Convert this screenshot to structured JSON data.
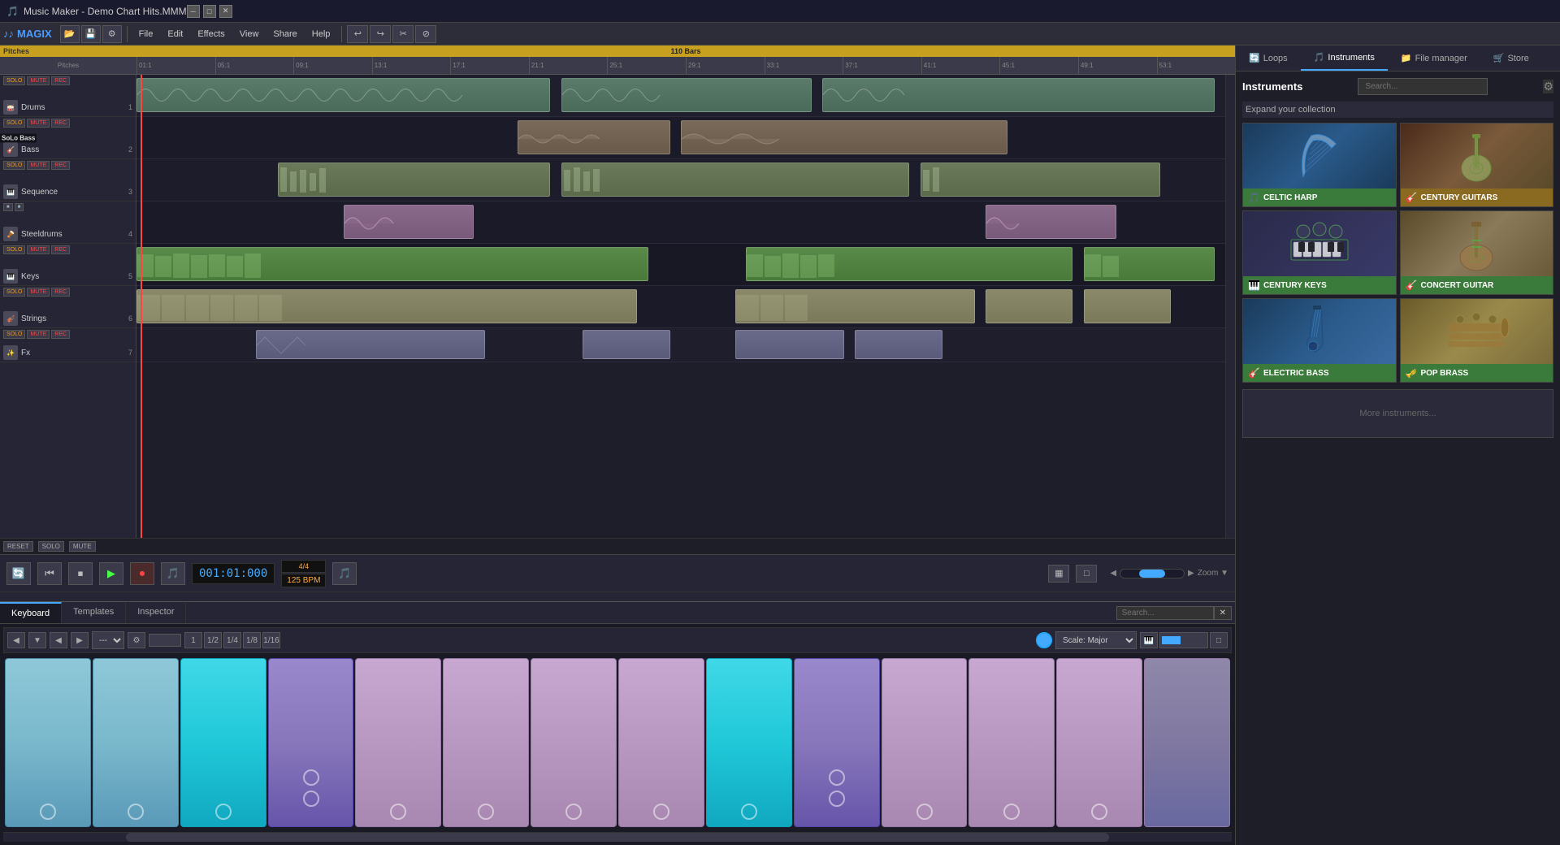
{
  "window": {
    "title": "Music Maker - Demo Chart Hits.MMM",
    "app_name": "Music Maker"
  },
  "titlebar": {
    "title": "Music Maker - Demo Chart Hits.MMM",
    "min_label": "─",
    "max_label": "□",
    "close_label": "✕"
  },
  "menubar": {
    "logo": "MAGIX",
    "items": [
      "File",
      "Edit",
      "Effects",
      "View",
      "Share",
      "Help"
    ]
  },
  "timeline": {
    "total_bars": "110 Bars",
    "markers": [
      "01:1",
      "05:1",
      "09:1",
      "13:1",
      "17:1",
      "21:1",
      "25:1",
      "29:1",
      "33:1",
      "37:1",
      "41:1",
      "45:1",
      "49:1",
      "53:1"
    ]
  },
  "tracks": [
    {
      "id": 1,
      "name": "Drums",
      "type": "drums",
      "icon": "🥁",
      "num": "1",
      "color": "#5a7a6a"
    },
    {
      "id": 2,
      "name": "Bass",
      "type": "bass",
      "icon": "🎸",
      "num": "2",
      "color": "#7a6a5a",
      "solo_label": "SoLo Bass"
    },
    {
      "id": 3,
      "name": "Sequence",
      "type": "seq",
      "icon": "🎹",
      "num": "3",
      "color": "#6a7a5a"
    },
    {
      "id": 4,
      "name": "Steeldrums",
      "type": "steel",
      "icon": "🪘",
      "num": "4",
      "color": "#8a6a8a"
    },
    {
      "id": 5,
      "name": "Keys",
      "type": "keys",
      "icon": "🎹",
      "num": "5",
      "color": "#5a8a4a"
    },
    {
      "id": 6,
      "name": "Strings",
      "type": "strings",
      "icon": "🎻",
      "num": "6",
      "color": "#8a8a6a"
    },
    {
      "id": 7,
      "name": "Fx",
      "type": "fx",
      "icon": "✨",
      "num": "7",
      "color": "#6a6a8a"
    }
  ],
  "transport": {
    "time": "001:01:000",
    "time_sig": "4/4",
    "bpm": "125",
    "bpm_label": "BPM",
    "zoom_label": "Zoom ▼"
  },
  "bottom_tabs": [
    "Keyboard",
    "Templates",
    "Inspector"
  ],
  "keyboard": {
    "scale_label": "Scale: Major",
    "keys": [
      {
        "color": "white",
        "dots": 1
      },
      {
        "color": "white",
        "dots": 1
      },
      {
        "color": "cyan",
        "dots": 1
      },
      {
        "color": "black",
        "dots": 2
      },
      {
        "color": "pink",
        "dots": 1
      },
      {
        "color": "pink",
        "dots": 1
      },
      {
        "color": "pink",
        "dots": 1
      },
      {
        "color": "pink",
        "dots": 1
      },
      {
        "color": "cyan",
        "dots": 1
      },
      {
        "color": "black",
        "dots": 2
      },
      {
        "color": "pink",
        "dots": 1
      },
      {
        "color": "pink",
        "dots": 1
      },
      {
        "color": "pink",
        "dots": 1
      }
    ]
  },
  "right_panel": {
    "tabs": [
      "Loops",
      "Instruments",
      "File manager",
      "Store"
    ],
    "active_tab": "Instruments",
    "panel_title": "Instruments",
    "search_placeholder": "Search...",
    "expand_label": "Expand your collection",
    "instruments": [
      {
        "name": "CELTIC HARP",
        "label": "CELTIC HARP",
        "icon": "🎵",
        "img_class": "harp-img",
        "label_color": "green"
      },
      {
        "name": "CENTURY GUITARS",
        "label": "CENTURY GUITARS",
        "icon": "🎸",
        "img_class": "guitar-img",
        "label_color": "orange"
      },
      {
        "name": "CENTURY KEYS",
        "label": "CENTURY KEYS",
        "icon": "🎹",
        "img_class": "keys-img",
        "label_color": "green"
      },
      {
        "name": "CONCERT GUITAR",
        "label": "CONCERT GUITAR",
        "icon": "🎸",
        "img_class": "concert-guitar-img",
        "label_color": "green"
      },
      {
        "name": "ELECTRIC BASS",
        "label": "ELECTRIC BASS",
        "icon": "🎸",
        "img_class": "bass-img",
        "label_color": "green"
      },
      {
        "name": "POP BRASS",
        "label": "POP BRASS",
        "icon": "🎺",
        "img_class": "brass-img",
        "label_color": "green"
      }
    ]
  },
  "reset_bar": {
    "reset_label": "RESET",
    "solo_label": "SOLO",
    "mute_label": "MUTE"
  },
  "pitches_label": "Pitches"
}
